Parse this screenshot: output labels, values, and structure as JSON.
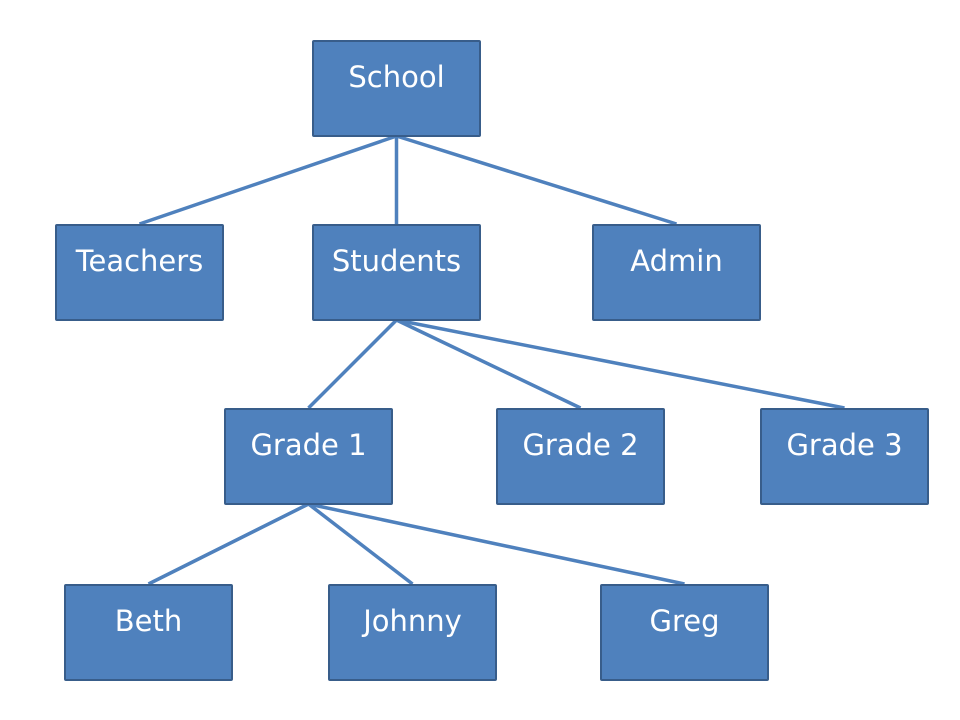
{
  "colors": {
    "fill": "#4F81BD",
    "border": "#385D8A",
    "link": "#4F81BD",
    "text": "#FFFFFF"
  },
  "nodes": [
    {
      "id": "school",
      "label": "School",
      "parent": null
    },
    {
      "id": "teachers",
      "label": "Teachers",
      "parent": "school"
    },
    {
      "id": "students",
      "label": "Students",
      "parent": "school"
    },
    {
      "id": "admin",
      "label": "Admin",
      "parent": "school"
    },
    {
      "id": "grade1",
      "label": "Grade 1",
      "parent": "students"
    },
    {
      "id": "grade2",
      "label": "Grade 2",
      "parent": "students"
    },
    {
      "id": "grade3",
      "label": "Grade 3",
      "parent": "students"
    },
    {
      "id": "beth",
      "label": "Beth",
      "parent": "grade1"
    },
    {
      "id": "johnny",
      "label": "Johnny",
      "parent": "grade1"
    },
    {
      "id": "greg",
      "label": "Greg",
      "parent": "grade1"
    }
  ]
}
